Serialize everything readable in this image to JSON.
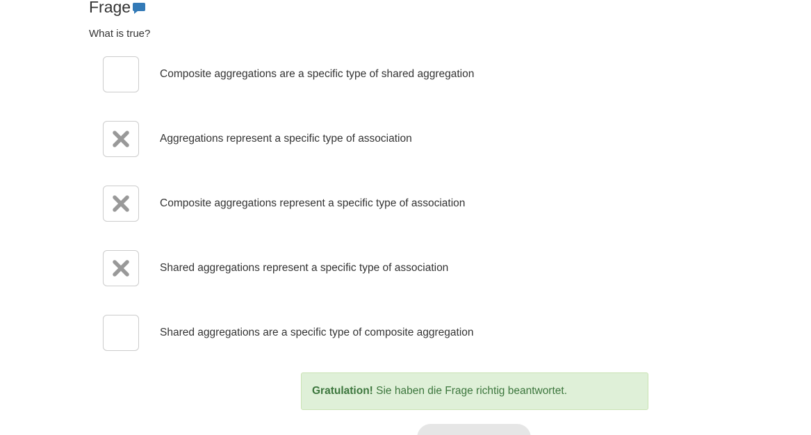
{
  "heading": {
    "title": "Frage",
    "icon": "comment-icon",
    "icon_color": "#337ab7"
  },
  "question": {
    "text": "What is true?"
  },
  "options": [
    {
      "label": "Composite aggregations are a specific type of shared aggregation",
      "checked": false
    },
    {
      "label": "Aggregations represent a specific type of association",
      "checked": true
    },
    {
      "label": "Composite aggregations represent a specific type of association",
      "checked": true
    },
    {
      "label": "Shared aggregations represent a specific type of association",
      "checked": true
    },
    {
      "label": "Shared aggregations are a specific type of composite aggregation",
      "checked": false
    }
  ],
  "check_icon": "cross-mark-icon",
  "check_color": "#999999",
  "feedback": {
    "strong": "Gratulation!",
    "message": " Sie haben die Frage richtig beantwortet.",
    "background": "#dff0d8",
    "text_color": "#3c763d"
  }
}
